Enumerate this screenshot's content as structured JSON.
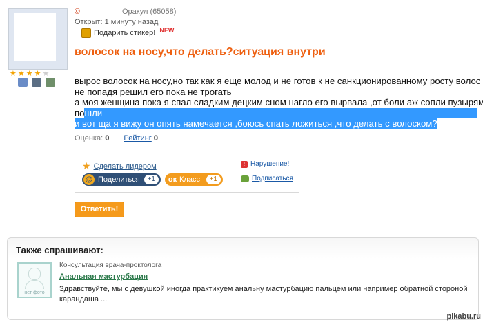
{
  "author": {
    "brand_mark": "©",
    "status": "Оракул (65058)",
    "stars_total": 5,
    "stars_filled": 4
  },
  "question": {
    "opened": "Открыт: 1 минуту назад",
    "sticker_link": "Подарить стикер!",
    "new_badge": "NEW",
    "title": "волосок на носу,что делать?ситуация внутри",
    "body_lines": [
      "вырос волосок на носу,но так как я еще молод и не готов к не санкционированному росту волос где",
      "не попадя решил его пока не трогать",
      "а моя женщина пока я спал сладким децким сном нагло его вырвала ,от боли аж сопли пузырями",
      "по",
      "шли",
      "и вот ща я вижу он опять намечается ,боюсь спать ложиться ,что делать с волоском?"
    ],
    "rating_label": "Оценка:",
    "rating_value": "0",
    "rank_label": "Рейтинг",
    "rank_value": "0"
  },
  "share_box": {
    "make_leader": "Сделать лидером",
    "violation": "Нарушение!",
    "subscribe": "Подписаться",
    "share_label": "Поделиться",
    "share_count": "+1",
    "ok_label": "Класс",
    "ok_count": "+1"
  },
  "answer_button": "Ответить!",
  "also_asked": {
    "title": "Также спрашивают:",
    "no_photo": "нет фото",
    "category": "Консультация врача-проктолога",
    "question": "Анальная мастурбация",
    "snippet": "Здравствуйте, мы с девушкой иногда практикуем анальну мастурбацию пальцем или например обратной стороной карандаша ..."
  },
  "watermark": "pikabu.ru",
  "colors": {
    "title_orange": "#ee6011",
    "selection_blue": "#3399ff",
    "link_blue": "#1a59a6",
    "answer_orange": "#f59a1b"
  }
}
